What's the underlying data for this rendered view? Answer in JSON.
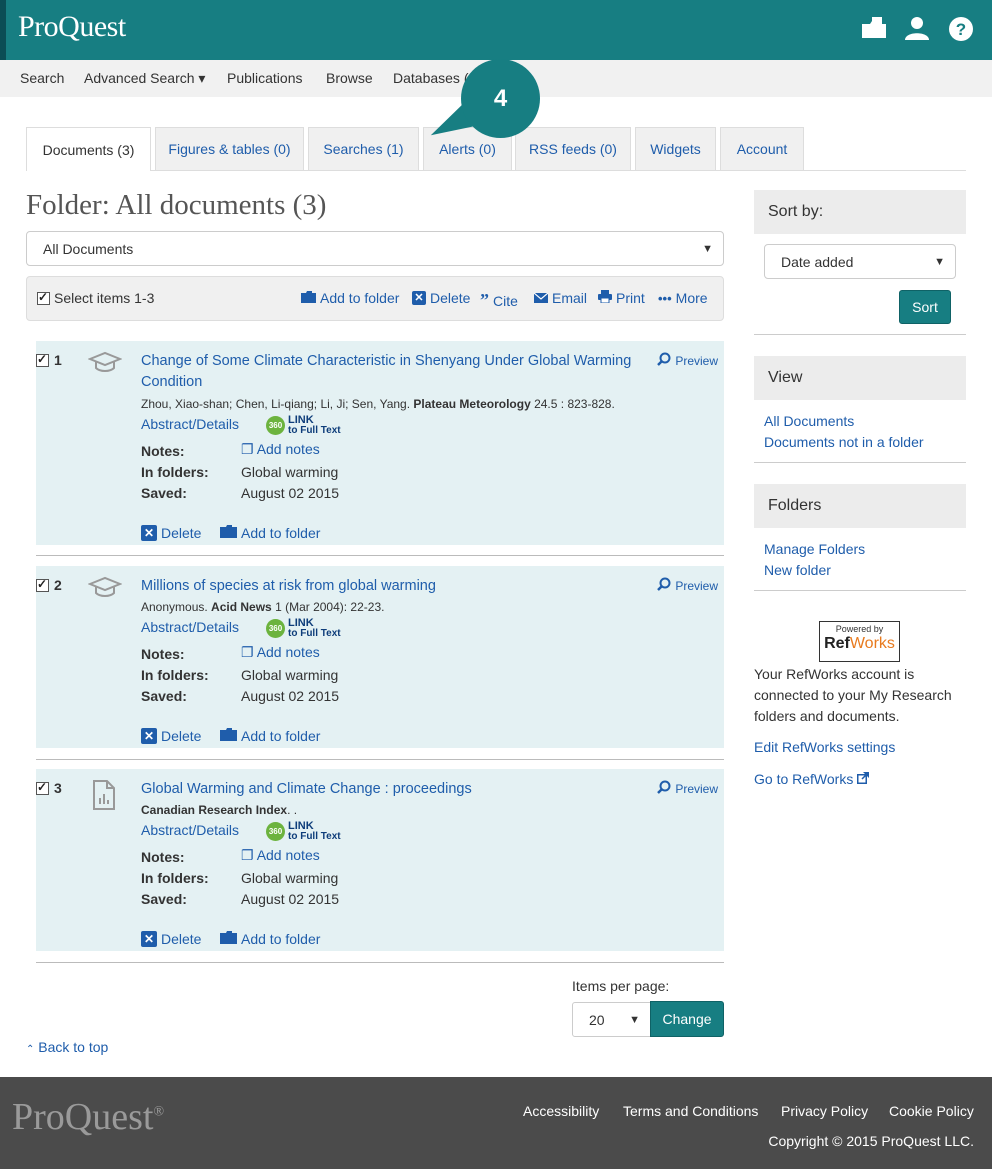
{
  "header": {
    "logo": "ProQuest",
    "icons": [
      "folder-icon",
      "user-icon",
      "help-icon"
    ]
  },
  "nav": {
    "items": [
      "Search",
      "Advanced Search ▾",
      "Publications",
      "Browse",
      "Databases ("
    ]
  },
  "callout": "4",
  "tabs": [
    {
      "label": "Documents (3)"
    },
    {
      "label": "Figures & tables (0)"
    },
    {
      "label": "Searches (1)"
    },
    {
      "label": "Alerts (0)"
    },
    {
      "label": "RSS feeds (0)"
    },
    {
      "label": "Widgets"
    },
    {
      "label": "Account"
    }
  ],
  "folder": {
    "title": "Folder: All documents (3)",
    "dropdown": "All Documents"
  },
  "actions": {
    "select_label": "Select items 1-3",
    "add_to_folder": "Add to folder",
    "delete": "Delete",
    "cite": "Cite",
    "email": "Email",
    "print": "Print",
    "more": "More"
  },
  "results": [
    {
      "num": "1",
      "title": "Change of Some Climate Characteristic in Shenyang Under Global Warming Condition",
      "cite_plain": "Zhou, Xiao-shan; Chen, Li-qiang; Li, Ji; Sen, Yang. ",
      "cite_bold": "Plateau Meteorology",
      "cite_rest": " 24.5 : 823-828.",
      "preview": "Preview",
      "abstract": "Abstract/Details",
      "notes_label": "Notes:",
      "add_notes": "Add notes",
      "folders_label": "In folders:",
      "folders_value": "Global warming",
      "saved_label": "Saved:",
      "saved_value": "August 02 2015",
      "delete": "Delete",
      "add_to_folder": "Add to folder"
    },
    {
      "num": "2",
      "title": "Millions of species at risk from global warming",
      "cite_plain": "Anonymous. ",
      "cite_bold": "Acid News",
      "cite_rest": " 1  (Mar 2004): 22-23.",
      "preview": "Preview",
      "abstract": "Abstract/Details",
      "notes_label": "Notes:",
      "add_notes": "Add notes",
      "folders_label": "In folders:",
      "folders_value": "Global warming",
      "saved_label": "Saved:",
      "saved_value": "August 02 2015",
      "delete": "Delete",
      "add_to_folder": "Add to folder"
    },
    {
      "num": "3",
      "title": "Global Warming and Climate Change : proceedings",
      "cite_plain": "",
      "cite_bold": "Canadian Research Index",
      "cite_rest": ". .",
      "preview": "Preview",
      "abstract": "Abstract/Details",
      "notes_label": "Notes:",
      "add_notes": "Add notes",
      "folders_label": "In folders:",
      "folders_value": "Global warming",
      "saved_label": "Saved:",
      "saved_value": "August 02 2015",
      "delete": "Delete",
      "add_to_folder": "Add to folder"
    }
  ],
  "link360": {
    "badge": "360",
    "line1": "LINK",
    "line2": "to Full Text"
  },
  "pagination": {
    "label": "Items per page:",
    "value": "20",
    "button": "Change"
  },
  "back_to_top": "Back to top",
  "sidebar": {
    "sort_by": "Sort by:",
    "sort_value": "Date added",
    "sort_button": "Sort",
    "view_head": "View",
    "view_links": [
      "All Documents",
      "Documents not in a folder"
    ],
    "folders_head": "Folders",
    "folder_links": [
      "Manage Folders",
      "New folder"
    ],
    "refworks_powered": "Powered by",
    "refworks_ref": "Ref",
    "refworks_works": "Works",
    "refworks_text": "Your RefWorks account is connected to your My Research folders and documents.",
    "edit_refworks": "Edit RefWorks settings",
    "go_refworks": "Go to RefWorks"
  },
  "footer": {
    "logo": "ProQuest",
    "logo_mark": "®",
    "links": [
      "Accessibility",
      "Terms and Conditions",
      "Privacy Policy",
      "Cookie Policy"
    ],
    "copyright": "Copyright © 2015 ProQuest LLC."
  },
  "colors": {
    "brand": "#177e82",
    "link": "#1f5dab",
    "result_bg": "#e4f1f3",
    "footer": "#4b4b4b"
  }
}
